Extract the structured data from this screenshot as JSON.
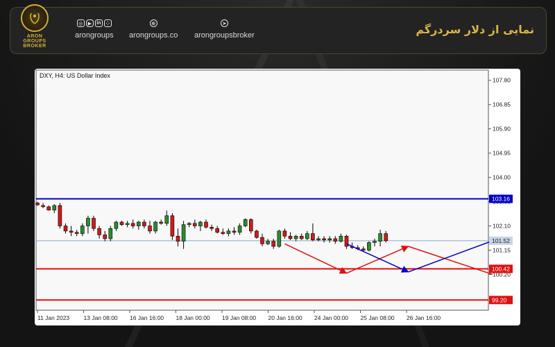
{
  "header": {
    "title": "نمایی از دلار سردرگم",
    "logo": {
      "line1": "ARON",
      "line2": "GROUPS",
      "line3": "BROKER"
    },
    "social": [
      {
        "label": "arongroups",
        "icons": [
          "instagram-icon",
          "youtube-icon",
          "linkedin-icon",
          "dice-icon"
        ]
      },
      {
        "label": "arongroups.co",
        "icons": [
          "globe-icon"
        ]
      },
      {
        "label": "arongroupsbroker",
        "icons": [
          "telegram-icon"
        ]
      }
    ]
  },
  "colors": {
    "bull": "#2e8b2e",
    "bear": "#d11a1a",
    "resistance": "#0000c8",
    "support": "#e01010",
    "current": "#8ba6c9",
    "gold": "#d4af37"
  },
  "chart_data": {
    "type": "candlestick",
    "title": "DXY, H4:  US Dollar Index",
    "ylim": [
      98.8,
      108.2
    ],
    "yticks": [
      "107.80",
      "106.85",
      "105.90",
      "104.95",
      "104.00",
      "103.05",
      "102.10",
      "101.15",
      "100.20"
    ],
    "xticks": [
      "11 Jan 2023",
      "13 Jan 08:00",
      "16 Jan 16:00",
      "18 Jan 00:00",
      "19 Jan 08:00",
      "20 Jan 16:00",
      "24 Jan 00:00",
      "25 Jan 08:00",
      "26 Jan 16:00"
    ],
    "levels": [
      {
        "value": 103.16,
        "label": "103.16",
        "kind": "resistance"
      },
      {
        "value": 101.52,
        "label": "101.52",
        "kind": "current"
      },
      {
        "value": 100.42,
        "label": "100.42",
        "kind": "support"
      },
      {
        "value": 99.2,
        "label": "99.20",
        "kind": "support"
      }
    ],
    "candles": [
      [
        103.0,
        103.05,
        102.9,
        102.92
      ],
      [
        102.9,
        103.0,
        102.8,
        102.85
      ],
      [
        102.85,
        102.9,
        102.7,
        102.72
      ],
      [
        102.72,
        102.95,
        102.6,
        102.9
      ],
      [
        102.9,
        103.0,
        102.0,
        102.1
      ],
      [
        102.1,
        102.2,
        101.8,
        101.9
      ],
      [
        101.9,
        102.1,
        101.7,
        101.85
      ],
      [
        101.85,
        101.95,
        101.7,
        101.8
      ],
      [
        101.8,
        102.2,
        101.7,
        102.1
      ],
      [
        102.1,
        102.5,
        101.8,
        102.4
      ],
      [
        102.4,
        102.5,
        101.9,
        102.0
      ],
      [
        102.0,
        102.1,
        101.6,
        101.75
      ],
      [
        101.75,
        101.9,
        101.5,
        101.6
      ],
      [
        101.6,
        102.1,
        101.5,
        102.0
      ],
      [
        102.0,
        102.3,
        101.9,
        102.25
      ],
      [
        102.25,
        102.3,
        102.1,
        102.15
      ],
      [
        102.15,
        102.3,
        102.05,
        102.2
      ],
      [
        102.2,
        102.35,
        102.0,
        102.1
      ],
      [
        102.1,
        102.3,
        101.95,
        102.25
      ],
      [
        102.25,
        102.35,
        102.0,
        102.1
      ],
      [
        102.1,
        102.3,
        101.8,
        101.9
      ],
      [
        101.9,
        102.3,
        101.8,
        102.25
      ],
      [
        102.25,
        102.35,
        102.15,
        102.2
      ],
      [
        102.2,
        102.7,
        102.1,
        102.5
      ],
      [
        102.5,
        102.6,
        101.55,
        101.7
      ],
      [
        101.7,
        102.0,
        101.3,
        101.5
      ],
      [
        101.5,
        102.3,
        101.2,
        102.15
      ],
      [
        102.15,
        102.25,
        102.05,
        102.2
      ],
      [
        102.2,
        102.35,
        102.0,
        102.1
      ],
      [
        102.1,
        102.3,
        101.9,
        102.25
      ],
      [
        102.25,
        102.35,
        102.0,
        102.05
      ],
      [
        102.05,
        102.15,
        101.9,
        102.0
      ],
      [
        102.0,
        102.1,
        101.8,
        101.85
      ],
      [
        101.85,
        102.0,
        101.75,
        101.8
      ],
      [
        101.8,
        102.0,
        101.7,
        101.9
      ],
      [
        101.9,
        102.05,
        101.75,
        101.85
      ],
      [
        101.85,
        102.2,
        101.75,
        102.1
      ],
      [
        102.1,
        102.4,
        102.05,
        102.35
      ],
      [
        102.35,
        102.4,
        101.8,
        101.9
      ],
      [
        101.9,
        101.95,
        101.6,
        101.65
      ],
      [
        101.65,
        101.8,
        101.3,
        101.4
      ],
      [
        101.4,
        101.6,
        101.35,
        101.5
      ],
      [
        101.5,
        101.6,
        101.2,
        101.3
      ],
      [
        101.3,
        101.95,
        101.25,
        101.9
      ],
      [
        101.9,
        102.0,
        101.6,
        101.7
      ],
      [
        101.7,
        101.85,
        101.55,
        101.6
      ],
      [
        101.6,
        101.75,
        101.5,
        101.7
      ],
      [
        101.7,
        101.8,
        101.55,
        101.6
      ],
      [
        101.6,
        101.9,
        101.55,
        101.8
      ],
      [
        101.8,
        102.2,
        101.5,
        101.55
      ],
      [
        101.55,
        101.7,
        101.5,
        101.6
      ],
      [
        101.6,
        101.7,
        101.45,
        101.55
      ],
      [
        101.55,
        101.7,
        101.45,
        101.6
      ],
      [
        101.6,
        101.7,
        101.4,
        101.5
      ],
      [
        101.5,
        101.8,
        101.45,
        101.7
      ],
      [
        101.7,
        101.75,
        101.2,
        101.3
      ],
      [
        101.3,
        101.45,
        101.2,
        101.25
      ],
      [
        101.25,
        101.35,
        101.15,
        101.2
      ],
      [
        101.2,
        101.3,
        101.1,
        101.15
      ],
      [
        101.15,
        101.5,
        101.1,
        101.45
      ],
      [
        101.45,
        101.6,
        101.3,
        101.5
      ],
      [
        101.5,
        101.95,
        101.3,
        101.8
      ],
      [
        101.8,
        101.9,
        101.45,
        101.52
      ]
    ],
    "projections": [
      {
        "color": "red",
        "points": [
          [
            44,
            101.4
          ],
          [
            55,
            100.25
          ],
          [
            66,
            101.3
          ],
          [
            81,
            100.2
          ]
        ]
      },
      {
        "color": "blue",
        "points": [
          [
            55,
            101.4
          ],
          [
            66,
            100.3
          ],
          [
            81,
            101.52
          ]
        ]
      }
    ]
  }
}
